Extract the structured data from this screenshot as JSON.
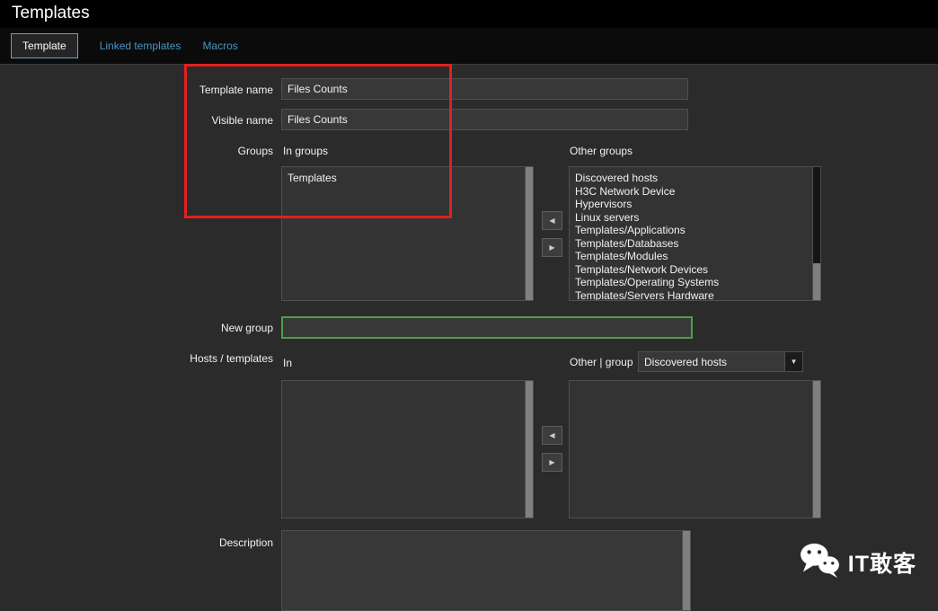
{
  "page": {
    "title": "Templates"
  },
  "tabs": [
    {
      "label": "Template",
      "active": true
    },
    {
      "label": "Linked templates",
      "active": false
    },
    {
      "label": "Macros",
      "active": false
    }
  ],
  "form": {
    "template_name": {
      "label": "Template name",
      "value": "Files Counts"
    },
    "visible_name": {
      "label": "Visible name",
      "value": "Files Counts"
    },
    "groups": {
      "label": "Groups",
      "in_label": "In groups",
      "in_items": [
        "Templates"
      ],
      "other_label": "Other groups",
      "other_items": [
        "Discovered hosts",
        "H3C Network Device",
        "Hypervisors",
        "Linux servers",
        "Templates/Applications",
        "Templates/Databases",
        "Templates/Modules",
        "Templates/Network Devices",
        "Templates/Operating Systems",
        "Templates/Servers Hardware"
      ]
    },
    "new_group": {
      "label": "New group",
      "value": ""
    },
    "hosts_templates": {
      "label": "Hosts / templates",
      "in_label": "In",
      "in_items": [],
      "other_label": "Other | group",
      "group_select": "Discovered hosts",
      "other_items": []
    },
    "description": {
      "label": "Description",
      "value": ""
    }
  },
  "icons": {
    "left_arrow": "◀",
    "right_arrow": "▶",
    "dropdown_arrow": "▼"
  },
  "colors": {
    "link_blue": "#4796c4",
    "annotation_red": "#e02020",
    "focus_green": "#4c9e4c"
  },
  "watermark": {
    "text": "IT敢客"
  }
}
